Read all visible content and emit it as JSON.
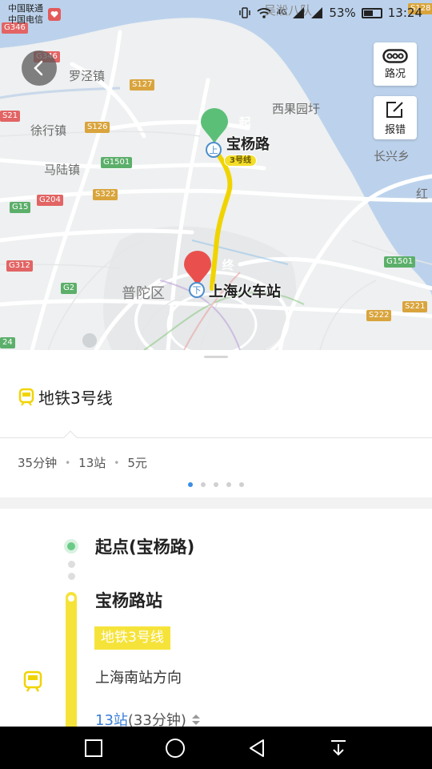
{
  "status_bar": {
    "carrier_1": "中国联通",
    "carrier_2": "中国电信",
    "network": "4G",
    "battery_percent": "53%",
    "time": "13:24"
  },
  "map": {
    "labels": {
      "luojing": "罗泾镇",
      "xuhang": "徐行镇",
      "malu": "马陆镇",
      "xiguo": "西果园圩",
      "changxing": "长兴乡",
      "putuo": "普陀区",
      "wusong": "吴淞八队",
      "hong": "红"
    },
    "road_badges": {
      "g346": "G346",
      "g346b": "G346",
      "s127": "S127",
      "s126": "S126",
      "g1501a": "G1501",
      "s322": "S322",
      "g204": "G204",
      "g15": "G15",
      "g312": "G312",
      "g2": "G2",
      "g1501b": "G1501",
      "s221": "S221",
      "s222": "S222",
      "s21": "S21",
      "s128": "S128",
      "g24": "24"
    },
    "start_pin": "起",
    "end_pin": "终",
    "start_station": "宝杨路",
    "end_station": "上海火车站",
    "line_tag": "3号线",
    "metro_up": "上",
    "metro_down": "下",
    "traffic_btn": "路况",
    "report_btn": "报错"
  },
  "panel": {
    "route_name": "地铁3号线",
    "summary": {
      "duration": "35分钟",
      "stations": "13站",
      "fare": "5元",
      "sep": "•"
    },
    "pager": {
      "count": 5,
      "active": 0
    },
    "start_label": "起点(宝杨路)",
    "station_name": "宝杨路站",
    "line_chip": "地铁3号线",
    "direction": "上海南站方向",
    "stops_link": "13站",
    "stops_time": "(33分钟)"
  },
  "colors": {
    "subway_line": "#f6e33a",
    "start_green": "#6acb86",
    "end_red": "#e9504d",
    "link_blue": "#3b80d8",
    "map_water": "#bcd2ec"
  }
}
